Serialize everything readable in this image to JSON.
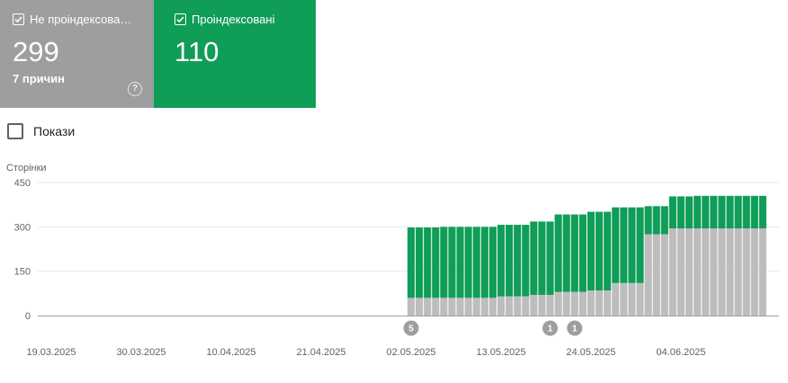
{
  "tiles": [
    {
      "label": "Не проіндексова…",
      "count": "299",
      "sub": "7 причин",
      "color": "#9e9e9e"
    },
    {
      "label": "Проіндексовані",
      "count": "110",
      "color": "#0f9d58"
    }
  ],
  "toggle": {
    "label": "Покази"
  },
  "icons": {
    "check": "check-icon",
    "help": "help-icon"
  },
  "chart_data": {
    "type": "bar",
    "stacked": true,
    "ylabel": "Сторінки",
    "ylim": [
      0,
      450
    ],
    "yticks": [
      "450",
      "300",
      "150",
      "0"
    ],
    "x_tick_labels": [
      "19.03.2025",
      "30.03.2025",
      "10.04.2025",
      "21.04.2025",
      "02.05.2025",
      "13.05.2025",
      "24.05.2025",
      "04.06.2025"
    ],
    "x_range": [
      "19.03.2025",
      "16.06.2025"
    ],
    "bars_start": "02.05.2025",
    "series": [
      {
        "color": "#bdbdbd",
        "values": [
          60,
          60,
          60,
          60,
          60,
          60,
          60,
          60,
          60,
          60,
          60,
          65,
          65,
          65,
          65,
          70,
          70,
          70,
          80,
          80,
          80,
          80,
          85,
          85,
          85,
          110,
          110,
          110,
          110,
          275,
          275,
          275,
          295,
          295,
          295,
          295,
          295,
          295,
          295,
          295,
          295,
          295,
          295,
          295
        ]
      },
      {
        "color": "#0f9d58",
        "values": [
          238,
          238,
          238,
          238,
          240,
          240,
          240,
          240,
          240,
          240,
          240,
          242,
          242,
          242,
          242,
          248,
          248,
          248,
          262,
          262,
          262,
          262,
          266,
          266,
          266,
          256,
          256,
          256,
          256,
          95,
          95,
          95,
          108,
          108,
          108,
          110,
          110,
          110,
          110,
          110,
          110,
          110,
          110,
          110
        ]
      }
    ],
    "annotations": [
      {
        "date": "02.05.2025",
        "label": "5"
      },
      {
        "date": "19.05.2025",
        "label": "1"
      },
      {
        "date": "22.05.2025",
        "label": "1"
      }
    ],
    "colors": {
      "grid": "#e8eaed",
      "axis": "#9aa0a6",
      "marker": "#9e9e9e"
    }
  }
}
